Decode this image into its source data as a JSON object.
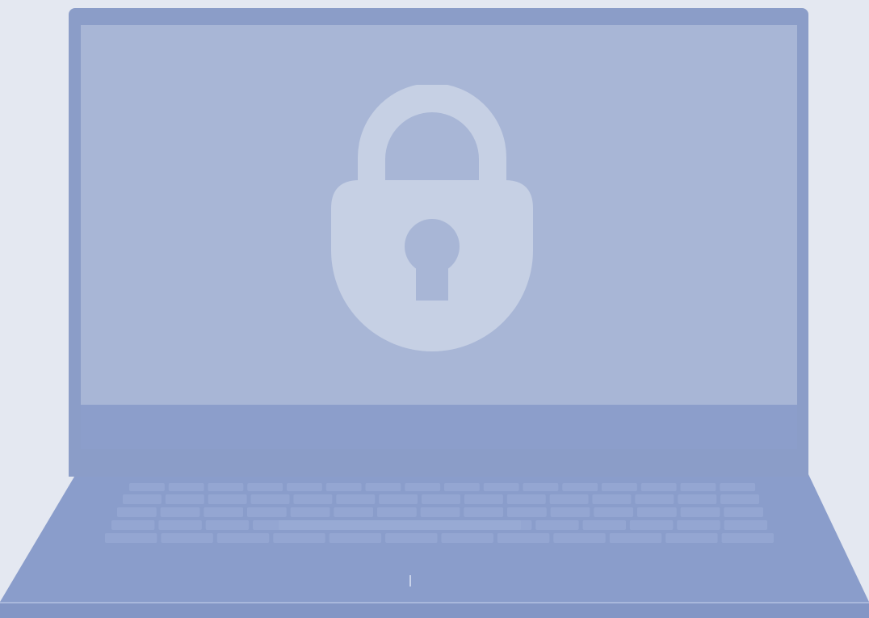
{
  "scene": {
    "subject": "laptop",
    "icons": [
      "laptop-icon",
      "lock-icon",
      "keyboard-icon",
      "trackpad-icon"
    ],
    "colors": {
      "background": "#e4e8f1",
      "laptop_body": "#8b9dc8",
      "screen": "#a8b6d6",
      "lock": "#c6d0e4",
      "keyhole": "#a8b6d6"
    }
  }
}
